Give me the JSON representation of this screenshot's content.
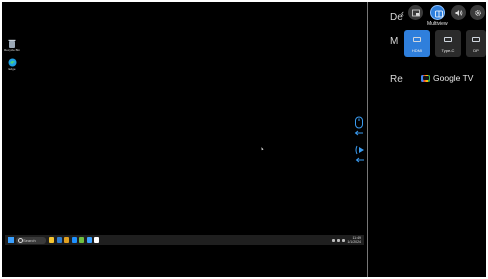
{
  "desktop": {
    "icons": [
      {
        "label": "Recycle Bin",
        "icon": "recycle-bin-icon"
      },
      {
        "label": "Edge",
        "icon": "edge-icon"
      }
    ],
    "taskbar": {
      "search_placeholder": "Search",
      "app_colors": [
        "#f4c430",
        "#2d7dd2",
        "#e0a020",
        "#1e90ff",
        "#6fbf40",
        "#3aa0ff",
        "#ffffff"
      ],
      "clock_time": "11:49",
      "clock_date": "1/1/2024"
    }
  },
  "kvm": {
    "mouse_icons": [
      "mouse-left-active-icon",
      "mouse-right-icon"
    ],
    "audio_icons": [
      "audio-left-active-icon",
      "speaker-right-icon"
    ]
  },
  "osd": {
    "background_text": [
      "De",
      "M",
      "Re"
    ],
    "top_buttons": [
      {
        "name": "pip-button",
        "icon": "picture-in-picture-icon"
      },
      {
        "name": "multiview-button",
        "icon": "multiview-icon",
        "active": true
      },
      {
        "name": "volume-button",
        "icon": "volume-icon"
      },
      {
        "name": "settings-button",
        "icon": "gear-icon"
      }
    ],
    "active_label": "Multiview",
    "inputs": [
      {
        "label": "HDMI",
        "selected": true
      },
      {
        "label": "Type-C",
        "selected": false
      },
      {
        "label": "DP",
        "selected": false
      }
    ],
    "google_tv_label": "Google TV",
    "accent_color": "#2f7fdc"
  }
}
